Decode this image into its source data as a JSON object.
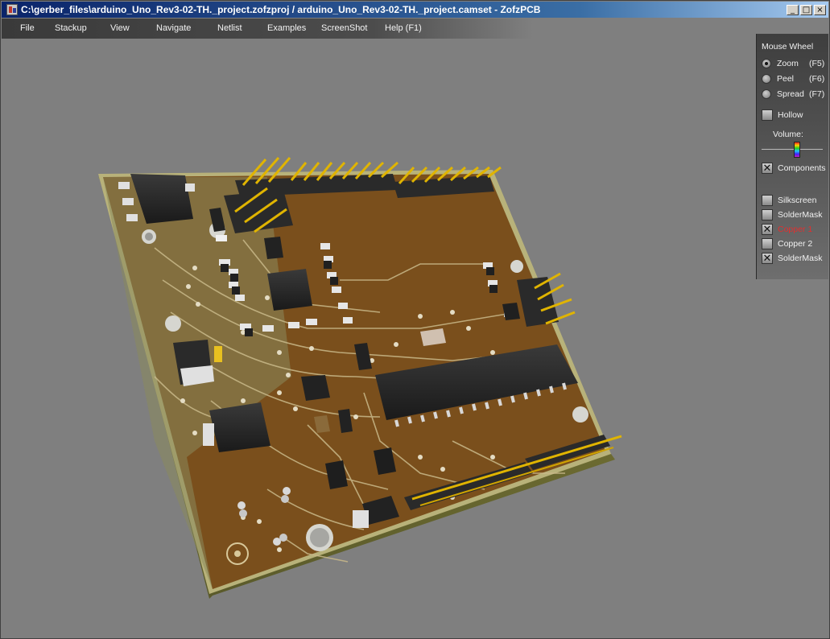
{
  "window": {
    "title": "C:\\gerber_files\\arduino_Uno_Rev3-02-TH._project.zofzproj / arduino_Uno_Rev3-02-TH._project.camset - ZofzPCB",
    "buttons": [
      "_",
      "□",
      "×"
    ]
  },
  "menu": [
    "File",
    "Stackup",
    "View",
    "Navigate",
    "Netlist",
    "Examples",
    "ScreenShot",
    "Help (F1)"
  ],
  "panel": {
    "mouse_wheel_label": "Mouse Wheel",
    "modes": [
      {
        "label": "Zoom",
        "key": "(F5)",
        "selected": true
      },
      {
        "label": "Peel",
        "key": "(F6)",
        "selected": false
      },
      {
        "label": "Spread",
        "key": "(F7)",
        "selected": false
      }
    ],
    "hollow": {
      "label": "Hollow",
      "checked": false
    },
    "volume_label": "Volume:",
    "volume_level": 0.6,
    "components": {
      "label": "Components",
      "checked": true
    },
    "layers": [
      {
        "label": "Silkscreen",
        "checked": false
      },
      {
        "label": "SolderMask",
        "checked": false
      },
      {
        "label": "Copper 1",
        "checked": true,
        "highlight": "#e03030"
      },
      {
        "label": "Copper 2",
        "checked": false
      },
      {
        "label": "SolderMask",
        "checked": true
      }
    ]
  },
  "colors": {
    "board": "#7a4f1c",
    "silk": "#cbbf8e",
    "pins": "#e0b400",
    "background": "#7f7f7f"
  }
}
